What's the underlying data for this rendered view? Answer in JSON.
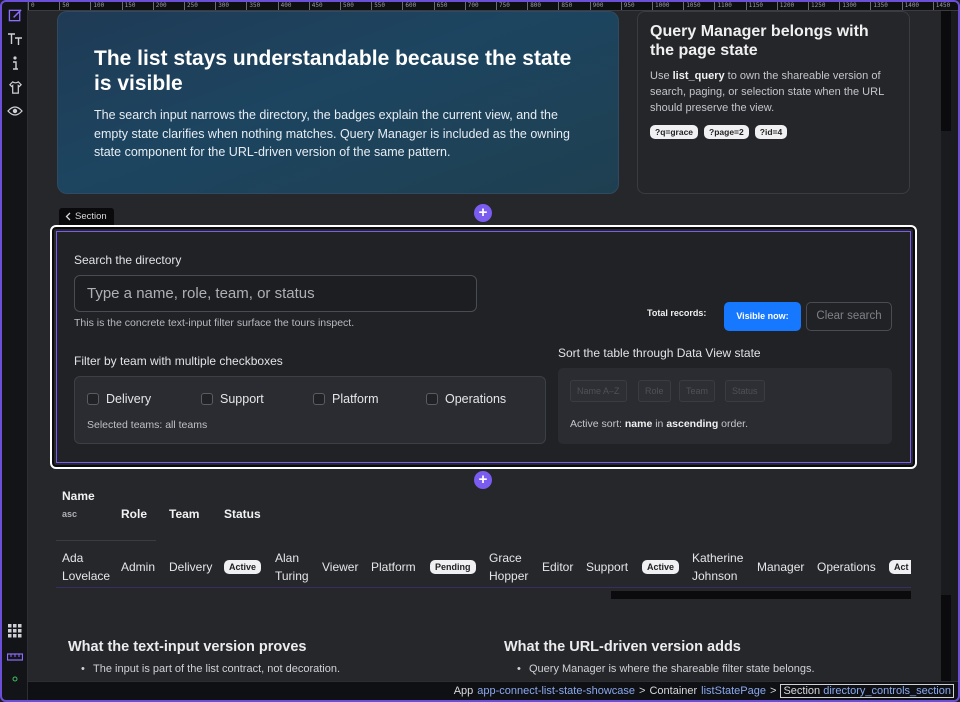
{
  "ruler": [
    "0",
    "50",
    "100",
    "150",
    "200",
    "250",
    "300",
    "350",
    "400",
    "450",
    "500",
    "550",
    "600",
    "650",
    "700",
    "750",
    "800",
    "850",
    "900",
    "950",
    "1000",
    "1050",
    "1100",
    "1150",
    "1200",
    "1250",
    "1300",
    "1350",
    "1400",
    "1450"
  ],
  "tools": [
    "edit-icon",
    "text-icon",
    "info-icon",
    "shirt-icon",
    "eye-icon"
  ],
  "bottom_tools": [
    "grid-icon",
    "ruler-icon"
  ],
  "hero": {
    "title": "The list stays understandable because the state is visible",
    "body": "The search input narrows the directory, the badges explain the current view, and the empty state clarifies when nothing matches. Query Manager is included as the owning state component for the URL-driven version of the same pattern."
  },
  "query_card": {
    "title": "Query Manager belongs with the page state",
    "body_pre": "Use ",
    "body_code": "list_query",
    "body_post": " to own the shareable version of search, paging, or selection state when the URL should preserve the view.",
    "chips": [
      "?q=grace",
      "?page=2",
      "?id=4"
    ]
  },
  "section_tag": "Section",
  "controls": {
    "search_label": "Search the directory",
    "search_placeholder": "Type a name, role, team, or status",
    "search_hint": "This is the concrete text-input filter surface the tours inspect.",
    "total_label": "Total records:",
    "visible_button": "Visible now:",
    "clear_button": "Clear search",
    "filter_label": "Filter by team with multiple checkboxes",
    "teams": [
      "Delivery",
      "Support",
      "Platform",
      "Operations"
    ],
    "selected_teams": "Selected teams: all teams",
    "sort_label": "Sort the table through Data View state",
    "sort_buttons": [
      "Name A–Z",
      "Role",
      "Team",
      "Status"
    ],
    "sort_active_pre": "Active sort: ",
    "sort_active_field": "name",
    "sort_active_mid": " in ",
    "sort_active_dir": "ascending",
    "sort_active_post": " order."
  },
  "table": {
    "headers": {
      "name": "Name",
      "name_sub": "asc",
      "role": "Role",
      "team": "Team",
      "status": "Status"
    },
    "rows": [
      {
        "name1": "Ada",
        "name2": "Lovelace",
        "role": "Admin",
        "team": "Delivery",
        "status": "Active"
      },
      {
        "name1": "Alan",
        "name2": "Turing",
        "role": "Viewer",
        "team": "Platform",
        "status": "Pending"
      },
      {
        "name1": "Grace",
        "name2": "Hopper",
        "role": "Editor",
        "team": "Support",
        "status": "Active"
      },
      {
        "name1": "Katherine",
        "name2": "Johnson",
        "role": "Manager",
        "team": "Operations",
        "status": "Act"
      }
    ]
  },
  "lower": {
    "left_title": "What the text-input version proves",
    "left_bullet": "The input is part of the list contract, not decoration.",
    "right_title": "What the URL-driven version adds",
    "right_bullet": "Query Manager is where the shareable filter state belongs."
  },
  "statusbar": {
    "app_label": "App",
    "app_name": "app-connect-list-state-showcase",
    "sep": ">",
    "container_label": "Container",
    "container_name": "listStatePage",
    "section_label": "Section",
    "section_name": "directory_controls_section"
  }
}
